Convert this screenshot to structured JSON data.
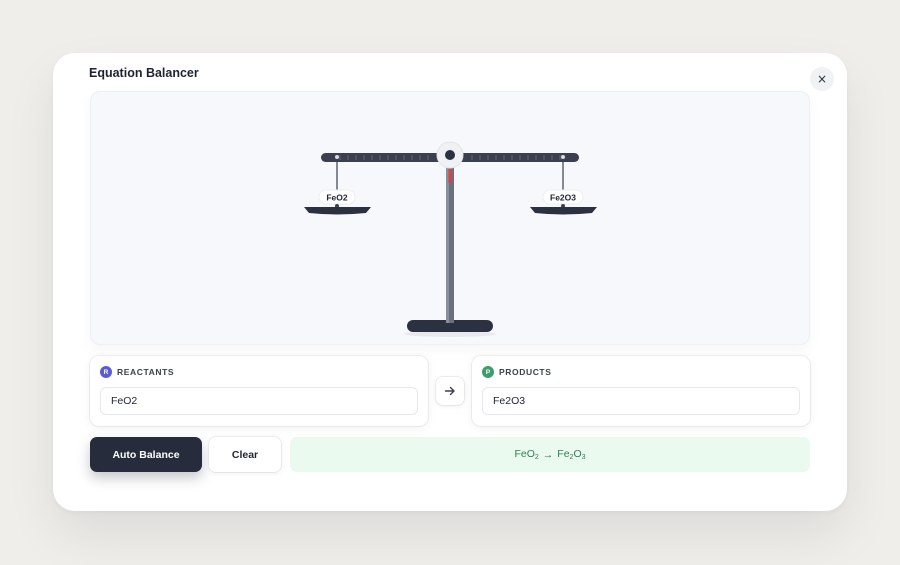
{
  "modal": {
    "title": "Equation Balancer",
    "close_label": "×"
  },
  "scale": {
    "left_label": "FeO2",
    "right_label": "Fe2O3"
  },
  "reactants": {
    "badge": "R",
    "label": "REACTANTS",
    "value": "FeO2",
    "badge_color": "#5b5bd6"
  },
  "products": {
    "badge": "P",
    "label": "PRODUCTS",
    "value": "Fe2O3",
    "badge_color": "#3f9c6b"
  },
  "actions": {
    "auto_balance": "Auto Balance",
    "clear": "Clear"
  },
  "result": {
    "reactant": {
      "base": "FeO",
      "sub": "2"
    },
    "arrow": "→",
    "product": {
      "base1": "Fe",
      "sub1": "2",
      "base2": "O",
      "sub2": "3"
    }
  },
  "colors": {
    "accent_dark": "#262c3b",
    "result_bg": "#eafaef",
    "result_text": "#2f7f50",
    "needle": "#d64545"
  }
}
